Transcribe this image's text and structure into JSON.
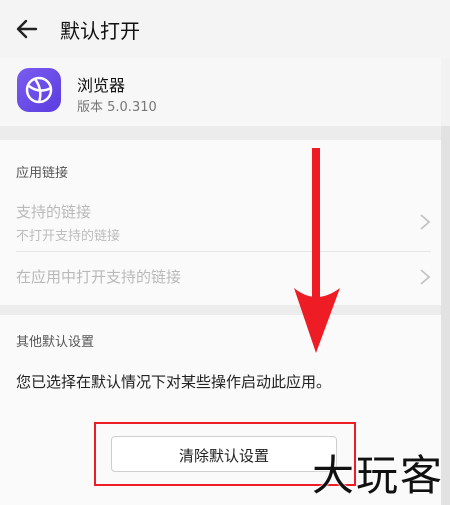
{
  "header": {
    "title": "默认打开"
  },
  "app": {
    "name": "浏览器",
    "version": "版本 5.0.310"
  },
  "links_section": {
    "title": "应用链接",
    "items": [
      {
        "title": "支持的链接",
        "subtitle": "不打开支持的链接"
      },
      {
        "title": "在应用中打开支持的链接"
      }
    ]
  },
  "defaults_section": {
    "title": "其他默认设置",
    "description": "您已选择在默认情况下对某些操作启动此应用。",
    "clear_label": "清除默认设置"
  },
  "watermark": "大玩客",
  "colors": {
    "accent_red": "#ee1c25",
    "app_icon": "#6a4ff0"
  }
}
